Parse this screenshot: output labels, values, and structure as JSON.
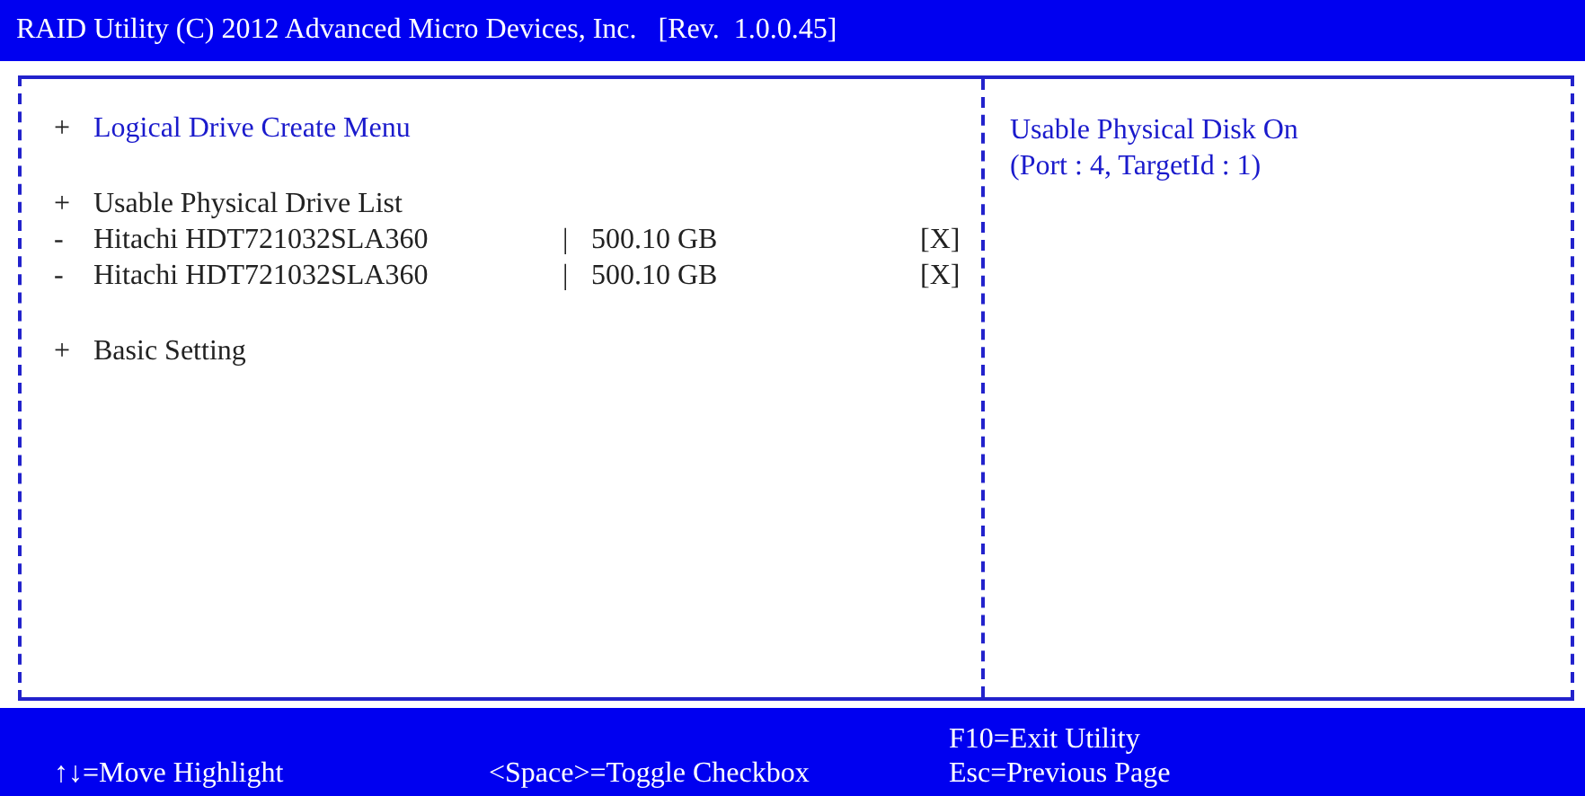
{
  "title": "RAID Utility (C) 2012 Advanced Micro Devices, Inc.   [Rev.  1.0.0.45]",
  "menu_groups": [
    [
      {
        "kind": "section",
        "marker": "+",
        "label": "Logical Drive Create Menu",
        "selected": true
      }
    ],
    [
      {
        "kind": "section",
        "marker": "+",
        "label": "Usable Physical Drive List",
        "selected": false
      },
      {
        "kind": "drive",
        "marker": "-",
        "label": "Hitachi HDT721032SLA360",
        "separator": "|",
        "size": "500.10 GB",
        "check": "[X]",
        "checked": true,
        "selected": false
      },
      {
        "kind": "drive",
        "marker": "-",
        "label": "Hitachi HDT721032SLA360",
        "separator": "|",
        "size": "500.10 GB",
        "check": "[X]",
        "checked": true,
        "selected": false
      }
    ],
    [
      {
        "kind": "section",
        "marker": "+",
        "label": "Basic Setting",
        "selected": false
      }
    ]
  ],
  "help": [
    "Usable Physical Disk On",
    "(Port : 4, TargetId : 1)"
  ],
  "footer": [
    {
      "lines": [
        "↑↓=Move Highlight"
      ]
    },
    {
      "lines": [
        "<Space>=Toggle Checkbox"
      ]
    },
    {
      "lines": [
        "F10=Exit Utility",
        "Esc=Previous Page"
      ]
    }
  ]
}
